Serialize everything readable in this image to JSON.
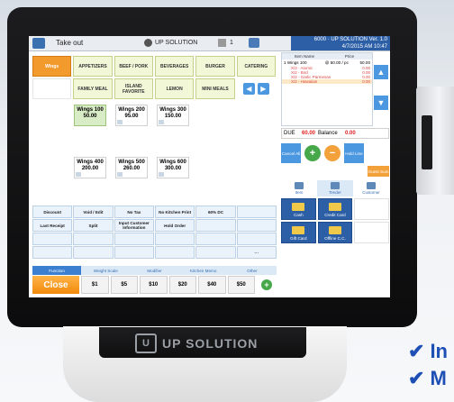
{
  "topbar": {
    "title": "Take out",
    "solution": "UP SOLUTION",
    "count": "1",
    "datetime_line1": "6000 · UP SOLUTION  Ver. 1.0",
    "datetime_line2": "4/7/2015 AM 10:47"
  },
  "categories": [
    {
      "label": "Wings",
      "active": true
    },
    {
      "label": "APPETIZERS"
    },
    {
      "label": "BEEF / PORK"
    },
    {
      "label": "BEVERAGES"
    },
    {
      "label": "BURGER"
    },
    {
      "label": "CATERING"
    },
    {
      "label": ""
    },
    {
      "label": "FAMILY MEAL"
    },
    {
      "label": "ISLAND FAVORITE"
    },
    {
      "label": "LEMON"
    },
    {
      "label": "MINI MEALS"
    }
  ],
  "items": [
    {
      "name": "Wings 100",
      "price": "50.00",
      "selected": true
    },
    {
      "name": "Wings 200",
      "price": "95.00"
    },
    {
      "name": "Wings 300",
      "price": "150.00"
    },
    {
      "name": "Wings 400",
      "price": "200.00"
    },
    {
      "name": "Wings 500",
      "price": "260.00"
    },
    {
      "name": "Wings 600",
      "price": "300.00"
    }
  ],
  "functions": [
    "Discount",
    "Void / Edit",
    "No Tax",
    "No Kitchen Print",
    "60% DC",
    "",
    "Last Receipt",
    "Split",
    "Input Customer Information",
    "Hold Order",
    "",
    "",
    "",
    "",
    "",
    "",
    "",
    "",
    "",
    "",
    "",
    "",
    "",
    "···"
  ],
  "modes": [
    {
      "label": "Function",
      "on": true
    },
    {
      "label": "Weight Scale"
    },
    {
      "label": "Modifier"
    },
    {
      "label": "Kitchen Memo"
    },
    {
      "label": "Other"
    }
  ],
  "close_label": "Close",
  "cash_buttons": [
    "$1",
    "$5",
    "$10",
    "$20",
    "$40",
    "$50"
  ],
  "order": {
    "headers": [
      "Item Name",
      "Price"
    ],
    "main_line": {
      "name": "1 Wings 100",
      "price": "@ 50.00 / pc",
      "amount": "50.00"
    },
    "mods": [
      {
        "name": "X/2 - Atomic",
        "amount": "0.00"
      },
      {
        "name": "X/2 - Bird",
        "amount": "0.00"
      },
      {
        "name": "X/2 - Garlic Parmesan",
        "amount": "0.00"
      },
      {
        "name": "X/2 - Hawaiian",
        "amount": "0.00",
        "hl": true
      }
    ]
  },
  "due": {
    "label": "DUE",
    "value": "60.00",
    "balance_label": "Balance",
    "balance_value": "0.00"
  },
  "controls": {
    "cancel": "Cancel All",
    "hold": "Hold Line",
    "guest": "Guest Sum"
  },
  "tabs": [
    {
      "label": "Item"
    },
    {
      "label": "Tender",
      "on": true
    },
    {
      "label": "Customer"
    }
  ],
  "pays": [
    {
      "label": "Cash"
    },
    {
      "label": "Credit Card"
    },
    {
      "label": ""
    },
    {
      "label": "Gift Card"
    },
    {
      "label": "Offline C.C."
    },
    {
      "label": ""
    }
  ],
  "stand_brand": "UP SOLUTION",
  "bullets": [
    "In",
    "M"
  ]
}
